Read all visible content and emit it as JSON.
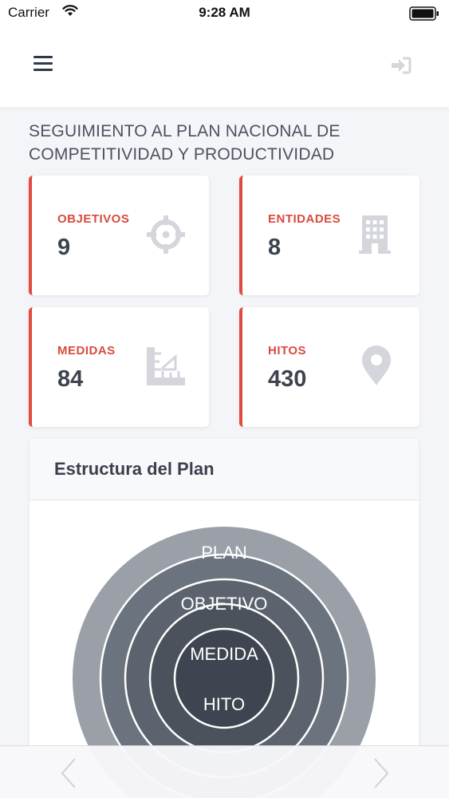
{
  "status_bar": {
    "carrier": "Carrier",
    "time": "9:28 AM"
  },
  "nav": {
    "menu_icon": "hamburger-icon",
    "login_icon": "sign-in-icon"
  },
  "page": {
    "title": "SEGUIMIENTO AL PLAN NACIONAL DE COMPETITIVIDAD Y PRODUCTIVIDAD"
  },
  "cards": [
    {
      "label": "OBJETIVOS",
      "value": "9",
      "icon": "crosshair-icon"
    },
    {
      "label": "ENTIDADES",
      "value": "8",
      "icon": "building-icon"
    },
    {
      "label": "MEDIDAS",
      "value": "84",
      "icon": "ruler-icon"
    },
    {
      "label": "HITOS",
      "value": "430",
      "icon": "map-marker-icon"
    }
  ],
  "structure": {
    "title": "Estructura del Plan",
    "levels": [
      "PLAN",
      "OBJETIVO",
      "MEDIDA",
      "HITO"
    ]
  },
  "colors": {
    "accent": "#e04a3f",
    "label": "#d84a3e",
    "icon": "#d4d6dc",
    "dark": "#3d4450"
  },
  "toolbar": {
    "back_icon": "chevron-left-icon",
    "forward_icon": "chevron-right-icon"
  }
}
